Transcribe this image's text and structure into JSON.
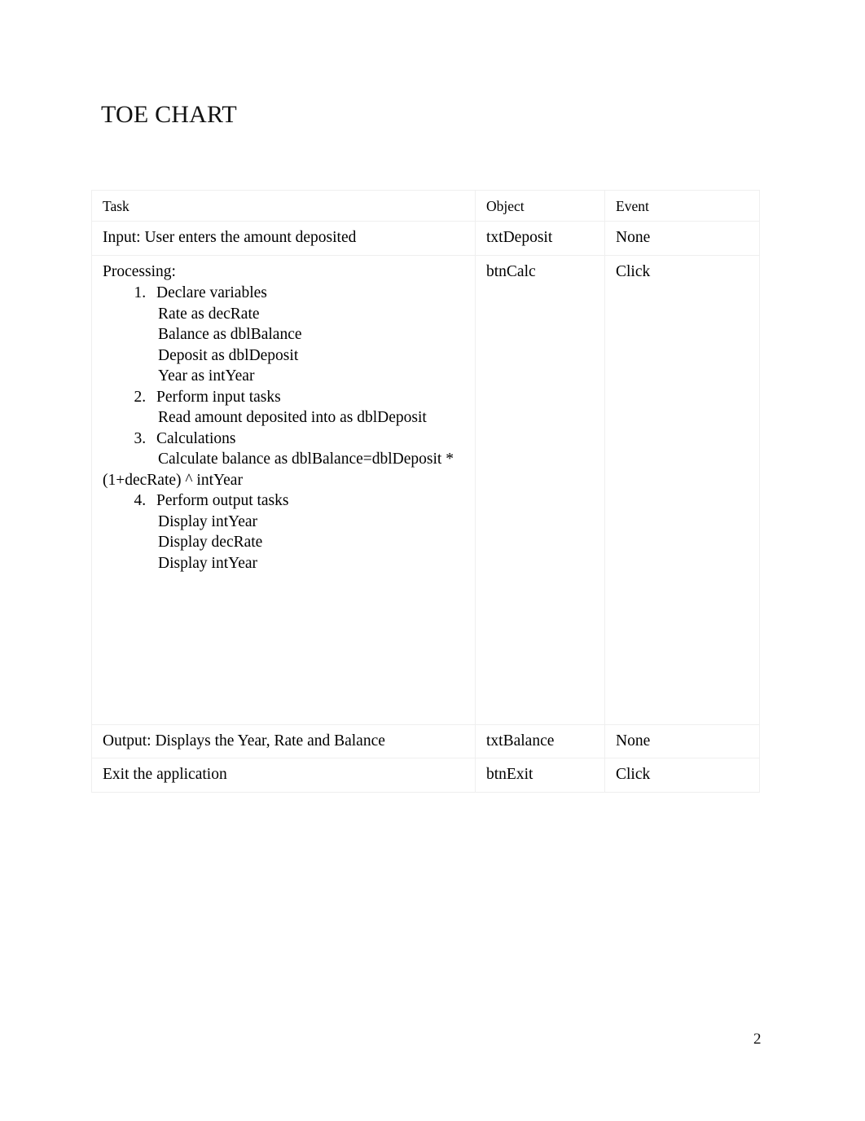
{
  "document": {
    "title": "TOE CHART",
    "page_number": "2"
  },
  "table": {
    "headers": {
      "task": "Task",
      "object": "Object",
      "event": "Event"
    },
    "rows": [
      {
        "task": "Input: User enters the amount deposited",
        "object": "txtDeposit",
        "event": "None"
      },
      {
        "task_heading": "Processing:",
        "object": "btnCalc",
        "event": "Click",
        "steps": [
          {
            "label": "Declare variables",
            "lines": [
              "Rate as decRate",
              "Balance as dblBalance",
              "Deposit as dblDeposit",
              "Year as intYear"
            ]
          },
          {
            "label": "Perform input tasks",
            "lines": [
              "Read amount deposited into as dblDeposit"
            ]
          },
          {
            "label": "Calculations",
            "lines": [
              "Calculate balance as dblBalance=dblDeposit *"
            ],
            "wrapped_line": "(1+decRate) ^ intYear"
          },
          {
            "label": "Perform output tasks",
            "lines": [
              "Display intYear",
              "Display decRate",
              "Display intYear"
            ]
          }
        ]
      },
      {
        "task": "Output: Displays the Year, Rate and Balance",
        "object": "txtBalance",
        "event": "None"
      },
      {
        "task": "Exit the application",
        "object": "btnExit",
        "event": "Click"
      }
    ]
  }
}
